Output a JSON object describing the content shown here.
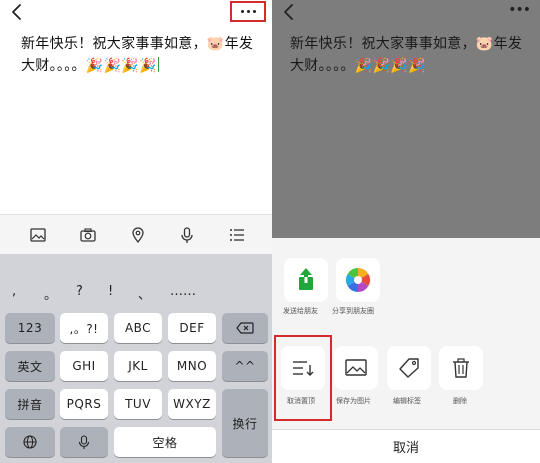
{
  "note": {
    "text": "新年快乐！祝大家事事如意，🐷年发大财。。。。🎉🎉🎉🎉"
  },
  "keyboard": {
    "candidates": [
      ",",
      "。",
      "?",
      "!",
      "、",
      "……"
    ],
    "keys": {
      "k123": "123",
      "punct": ",。?!",
      "abc": "ABC",
      "def": "DEF",
      "english": "英文",
      "ghi": "GHI",
      "jkl": "JKL",
      "mno": "MNO",
      "caret": "^^",
      "pinyin": "拼音",
      "pqrs": "PQRS",
      "tuv": "TUV",
      "wxyz": "WXYZ",
      "newline": "换行",
      "space": "空格"
    }
  },
  "share": {
    "send_friend": "发送给朋友",
    "moments": "分享到朋友圈"
  },
  "actions": {
    "unpin": "取消置顶",
    "save_image": "保存为图片",
    "edit_tags": "编辑标签",
    "delete": "删除"
  },
  "cancel_label": "取消",
  "colors": {
    "highlight": "#d62b2b",
    "share_green": "#1fa73a"
  }
}
